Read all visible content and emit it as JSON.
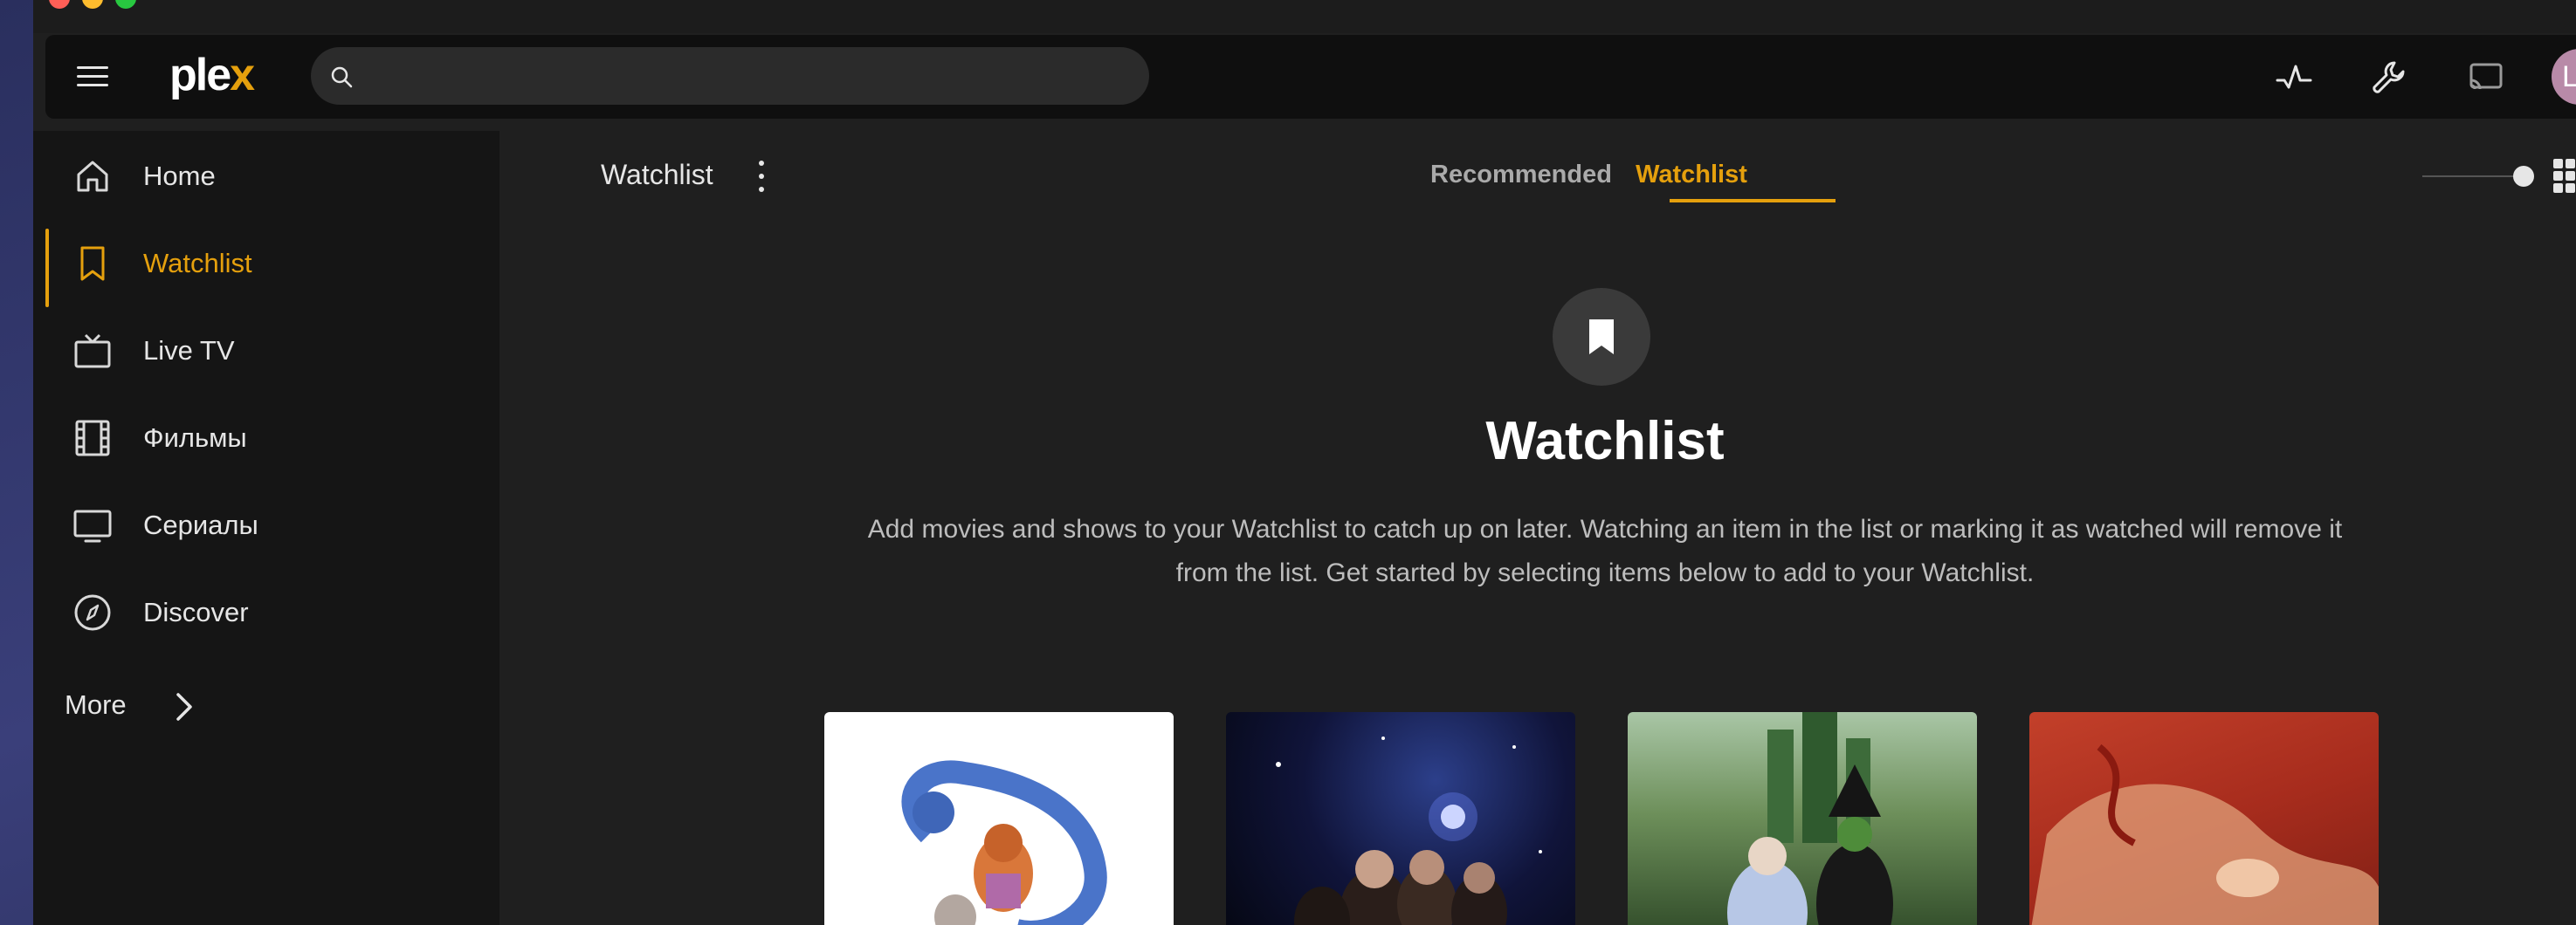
{
  "app": {
    "logo_text": "ple",
    "logo_accent": "x",
    "brand_color": "#e5a00d"
  },
  "search": {
    "placeholder": "",
    "value": ""
  },
  "user": {
    "avatar_initial": "L"
  },
  "sidebar": {
    "items": [
      {
        "label": "Home",
        "icon": "home-icon",
        "active": false
      },
      {
        "label": "Watchlist",
        "icon": "bookmark-icon",
        "active": true
      },
      {
        "label": "Live TV",
        "icon": "tv-icon",
        "active": false
      },
      {
        "label": "Фильмы",
        "icon": "film-icon",
        "active": false
      },
      {
        "label": "Сериалы",
        "icon": "monitor-icon",
        "active": false
      },
      {
        "label": "Discover",
        "icon": "compass-icon",
        "active": false
      }
    ],
    "more_label": "More"
  },
  "main": {
    "title": "Watchlist",
    "tabs": [
      {
        "label": "Recommended",
        "active": false
      },
      {
        "label": "Watchlist",
        "active": true
      }
    ],
    "empty_state": {
      "title": "Watchlist",
      "description": "Add movies and shows to your Watchlist to catch up on later. Watching an item in the list or marking it as watched will remove it from the list. Get started by selecting items below to add to your Watchlist."
    },
    "posters": [
      {
        "name": "poster-zootopia"
      },
      {
        "name": "poster-stranger-things"
      },
      {
        "name": "poster-wicked"
      },
      {
        "name": "poster-red-artwork"
      }
    ]
  }
}
